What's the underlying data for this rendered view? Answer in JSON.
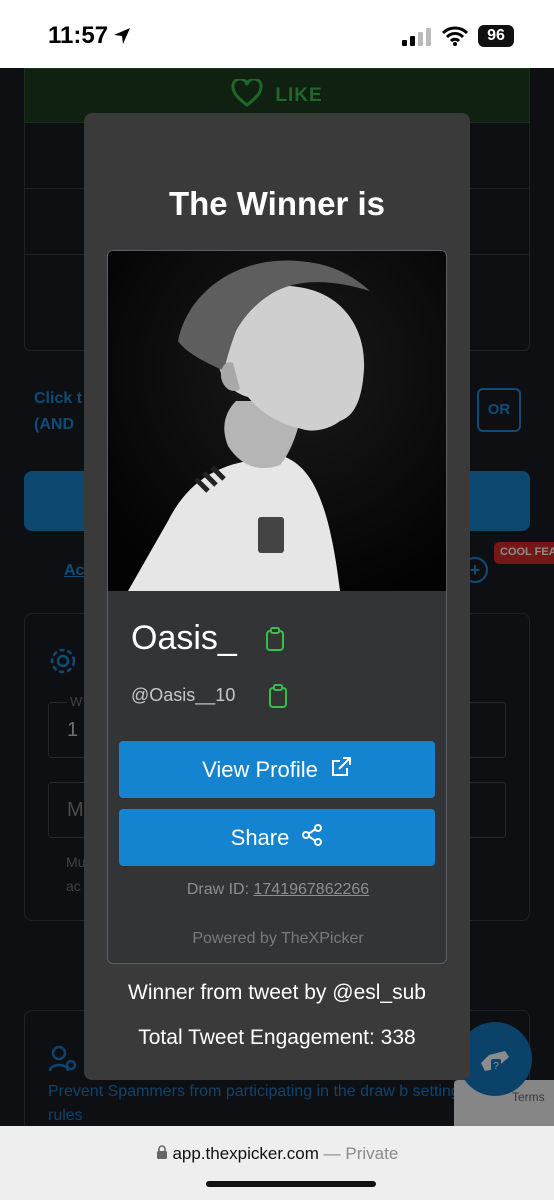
{
  "status_bar": {
    "time": "11:57",
    "battery": "96"
  },
  "background": {
    "like_label": "LIKE",
    "click_text_line1": "Click t",
    "click_text_line2": "(AND",
    "or_label": "OR",
    "link_fragment": "Ac",
    "cool_badge": "COOL FEA",
    "input_a_label": "W",
    "input_a_value": "1",
    "input_b_value": "M",
    "hint_line1": "Mu",
    "hint_line2": "ac",
    "rules_text": "Prevent Spammers from participating in the draw b setting rules",
    "recaptcha_terms": "Terms"
  },
  "modal": {
    "title": "The Winner is",
    "winner_name": "Oasis_",
    "winner_handle": "@Oasis__10",
    "view_profile_label": "View Profile",
    "share_label": "Share",
    "draw_id_label": "Draw ID:",
    "draw_id_value": "1741967862266",
    "powered_by": "Powered by TheXPicker",
    "tweet_by": "Winner from tweet by @esl_sub",
    "engagement": "Total Tweet Engagement: 338"
  },
  "url_bar": {
    "domain": "app.thexpicker.com",
    "separator": " — ",
    "mode": "Private"
  },
  "colors": {
    "accent": "#1484d0",
    "copy_green": "#3bbd4b",
    "modal_bg": "#3a3a3b"
  }
}
